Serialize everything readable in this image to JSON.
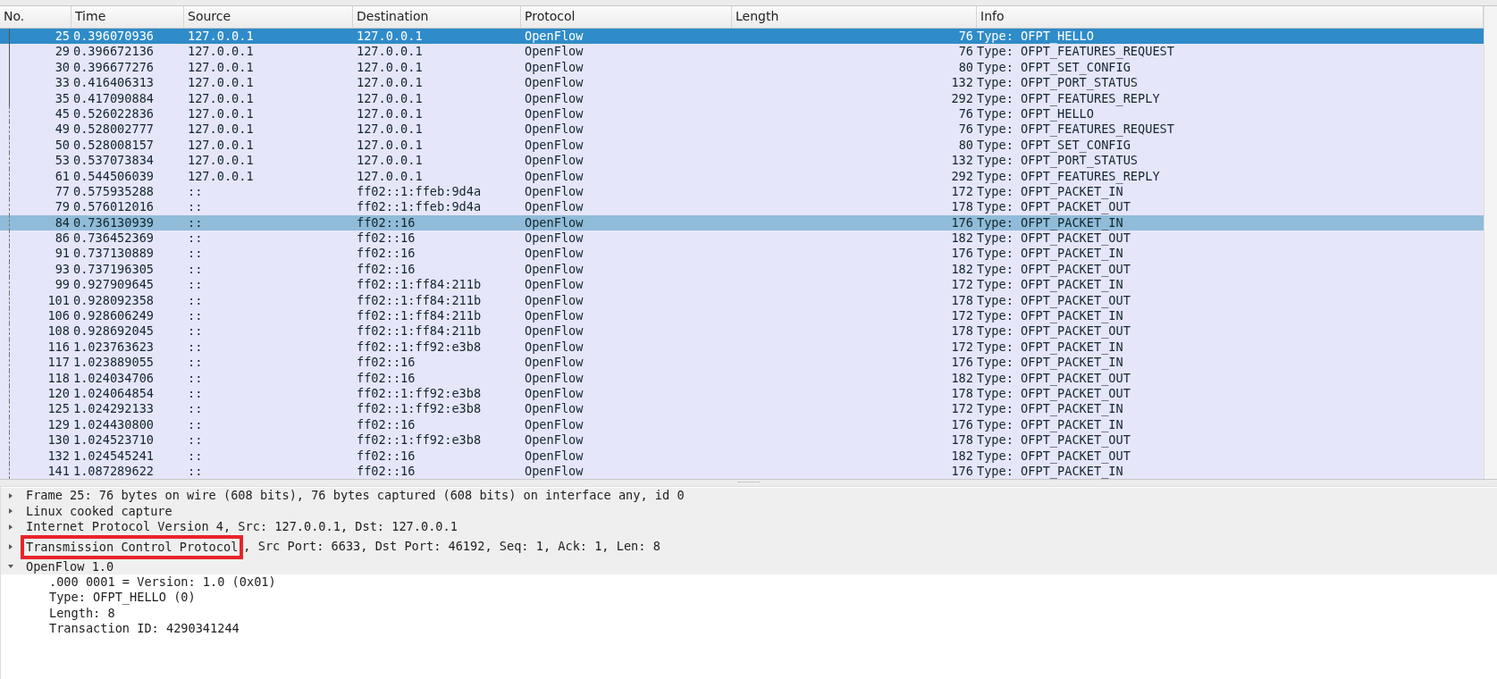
{
  "packet_list": {
    "columns": [
      "No.",
      "Time",
      "Source",
      "Destination",
      "Protocol",
      "Length",
      "Info"
    ],
    "rows": [
      {
        "no": "25",
        "time": "0.396070936",
        "source": "127.0.0.1",
        "destination": "127.0.0.1",
        "protocol": "OpenFlow",
        "length": "76",
        "info": "Type: OFPT_HELLO",
        "selected": true,
        "highlighted": false,
        "same_conversation": true
      },
      {
        "no": "29",
        "time": "0.396672136",
        "source": "127.0.0.1",
        "destination": "127.0.0.1",
        "protocol": "OpenFlow",
        "length": "76",
        "info": "Type: OFPT_FEATURES_REQUEST",
        "selected": false,
        "highlighted": false,
        "same_conversation": true
      },
      {
        "no": "30",
        "time": "0.396677276",
        "source": "127.0.0.1",
        "destination": "127.0.0.1",
        "protocol": "OpenFlow",
        "length": "80",
        "info": "Type: OFPT_SET_CONFIG",
        "selected": false,
        "highlighted": false,
        "same_conversation": true
      },
      {
        "no": "33",
        "time": "0.416406313",
        "source": "127.0.0.1",
        "destination": "127.0.0.1",
        "protocol": "OpenFlow",
        "length": "132",
        "info": "Type: OFPT_PORT_STATUS",
        "selected": false,
        "highlighted": false,
        "same_conversation": true
      },
      {
        "no": "35",
        "time": "0.417090884",
        "source": "127.0.0.1",
        "destination": "127.0.0.1",
        "protocol": "OpenFlow",
        "length": "292",
        "info": "Type: OFPT_FEATURES_REPLY",
        "selected": false,
        "highlighted": false,
        "same_conversation": true
      },
      {
        "no": "45",
        "time": "0.526022836",
        "source": "127.0.0.1",
        "destination": "127.0.0.1",
        "protocol": "OpenFlow",
        "length": "76",
        "info": "Type: OFPT_HELLO",
        "selected": false,
        "highlighted": false,
        "same_conversation": false
      },
      {
        "no": "49",
        "time": "0.528002777",
        "source": "127.0.0.1",
        "destination": "127.0.0.1",
        "protocol": "OpenFlow",
        "length": "76",
        "info": "Type: OFPT_FEATURES_REQUEST",
        "selected": false,
        "highlighted": false,
        "same_conversation": false
      },
      {
        "no": "50",
        "time": "0.528008157",
        "source": "127.0.0.1",
        "destination": "127.0.0.1",
        "protocol": "OpenFlow",
        "length": "80",
        "info": "Type: OFPT_SET_CONFIG",
        "selected": false,
        "highlighted": false,
        "same_conversation": false
      },
      {
        "no": "53",
        "time": "0.537073834",
        "source": "127.0.0.1",
        "destination": "127.0.0.1",
        "protocol": "OpenFlow",
        "length": "132",
        "info": "Type: OFPT_PORT_STATUS",
        "selected": false,
        "highlighted": false,
        "same_conversation": false
      },
      {
        "no": "61",
        "time": "0.544506039",
        "source": "127.0.0.1",
        "destination": "127.0.0.1",
        "protocol": "OpenFlow",
        "length": "292",
        "info": "Type: OFPT_FEATURES_REPLY",
        "selected": false,
        "highlighted": false,
        "same_conversation": false
      },
      {
        "no": "77",
        "time": "0.575935288",
        "source": "::",
        "destination": "ff02::1:ffeb:9d4a",
        "protocol": "OpenFlow",
        "length": "172",
        "info": "Type: OFPT_PACKET_IN",
        "selected": false,
        "highlighted": false,
        "same_conversation": false
      },
      {
        "no": "79",
        "time": "0.576012016",
        "source": "::",
        "destination": "ff02::1:ffeb:9d4a",
        "protocol": "OpenFlow",
        "length": "178",
        "info": "Type: OFPT_PACKET_OUT",
        "selected": false,
        "highlighted": false,
        "same_conversation": false
      },
      {
        "no": "84",
        "time": "0.736130939",
        "source": "::",
        "destination": "ff02::16",
        "protocol": "OpenFlow",
        "length": "176",
        "info": "Type: OFPT_PACKET_IN",
        "selected": false,
        "highlighted": true,
        "same_conversation": false
      },
      {
        "no": "86",
        "time": "0.736452369",
        "source": "::",
        "destination": "ff02::16",
        "protocol": "OpenFlow",
        "length": "182",
        "info": "Type: OFPT_PACKET_OUT",
        "selected": false,
        "highlighted": false,
        "same_conversation": false
      },
      {
        "no": "91",
        "time": "0.737130889",
        "source": "::",
        "destination": "ff02::16",
        "protocol": "OpenFlow",
        "length": "176",
        "info": "Type: OFPT_PACKET_IN",
        "selected": false,
        "highlighted": false,
        "same_conversation": false
      },
      {
        "no": "93",
        "time": "0.737196305",
        "source": "::",
        "destination": "ff02::16",
        "protocol": "OpenFlow",
        "length": "182",
        "info": "Type: OFPT_PACKET_OUT",
        "selected": false,
        "highlighted": false,
        "same_conversation": false
      },
      {
        "no": "99",
        "time": "0.927909645",
        "source": "::",
        "destination": "ff02::1:ff84:211b",
        "protocol": "OpenFlow",
        "length": "172",
        "info": "Type: OFPT_PACKET_IN",
        "selected": false,
        "highlighted": false,
        "same_conversation": false
      },
      {
        "no": "101",
        "time": "0.928092358",
        "source": "::",
        "destination": "ff02::1:ff84:211b",
        "protocol": "OpenFlow",
        "length": "178",
        "info": "Type: OFPT_PACKET_OUT",
        "selected": false,
        "highlighted": false,
        "same_conversation": false
      },
      {
        "no": "106",
        "time": "0.928606249",
        "source": "::",
        "destination": "ff02::1:ff84:211b",
        "protocol": "OpenFlow",
        "length": "172",
        "info": "Type: OFPT_PACKET_IN",
        "selected": false,
        "highlighted": false,
        "same_conversation": false
      },
      {
        "no": "108",
        "time": "0.928692045",
        "source": "::",
        "destination": "ff02::1:ff84:211b",
        "protocol": "OpenFlow",
        "length": "178",
        "info": "Type: OFPT_PACKET_OUT",
        "selected": false,
        "highlighted": false,
        "same_conversation": false
      },
      {
        "no": "116",
        "time": "1.023763623",
        "source": "::",
        "destination": "ff02::1:ff92:e3b8",
        "protocol": "OpenFlow",
        "length": "172",
        "info": "Type: OFPT_PACKET_IN",
        "selected": false,
        "highlighted": false,
        "same_conversation": false
      },
      {
        "no": "117",
        "time": "1.023889055",
        "source": "::",
        "destination": "ff02::16",
        "protocol": "OpenFlow",
        "length": "176",
        "info": "Type: OFPT_PACKET_IN",
        "selected": false,
        "highlighted": false,
        "same_conversation": false
      },
      {
        "no": "118",
        "time": "1.024034706",
        "source": "::",
        "destination": "ff02::16",
        "protocol": "OpenFlow",
        "length": "182",
        "info": "Type: OFPT_PACKET_OUT",
        "selected": false,
        "highlighted": false,
        "same_conversation": false
      },
      {
        "no": "120",
        "time": "1.024064854",
        "source": "::",
        "destination": "ff02::1:ff92:e3b8",
        "protocol": "OpenFlow",
        "length": "178",
        "info": "Type: OFPT_PACKET_OUT",
        "selected": false,
        "highlighted": false,
        "same_conversation": false
      },
      {
        "no": "125",
        "time": "1.024292133",
        "source": "::",
        "destination": "ff02::1:ff92:e3b8",
        "protocol": "OpenFlow",
        "length": "172",
        "info": "Type: OFPT_PACKET_IN",
        "selected": false,
        "highlighted": false,
        "same_conversation": false
      },
      {
        "no": "129",
        "time": "1.024430800",
        "source": "::",
        "destination": "ff02::16",
        "protocol": "OpenFlow",
        "length": "176",
        "info": "Type: OFPT_PACKET_IN",
        "selected": false,
        "highlighted": false,
        "same_conversation": false
      },
      {
        "no": "130",
        "time": "1.024523710",
        "source": "::",
        "destination": "ff02::1:ff92:e3b8",
        "protocol": "OpenFlow",
        "length": "178",
        "info": "Type: OFPT_PACKET_OUT",
        "selected": false,
        "highlighted": false,
        "same_conversation": false
      },
      {
        "no": "132",
        "time": "1.024545241",
        "source": "::",
        "destination": "ff02::16",
        "protocol": "OpenFlow",
        "length": "182",
        "info": "Type: OFPT_PACKET_OUT",
        "selected": false,
        "highlighted": false,
        "same_conversation": false
      },
      {
        "no": "141",
        "time": "1.087289622",
        "source": "::",
        "destination": "ff02::16",
        "protocol": "OpenFlow",
        "length": "176",
        "info": "Type: OFPT_PACKET_IN",
        "selected": false,
        "highlighted": false,
        "same_conversation": false
      }
    ]
  },
  "packet_details": [
    {
      "name": "Frame 25: 76 bytes on wire (608 bits), 76 bytes captured (608 bits) on interface any, id 0",
      "expanded": false,
      "annotated": false
    },
    {
      "name": "Linux cooked capture",
      "expanded": false,
      "annotated": false
    },
    {
      "name": "Internet Protocol Version 4, Src: 127.0.0.1, Dst: 127.0.0.1",
      "expanded": false,
      "annotated": false
    },
    {
      "name": "Transmission Control Protocol",
      "summary": ", Src Port: 6633, Dst Port: 46192, Seq: 1, Ack: 1, Len: 8",
      "expanded": false,
      "annotated": true
    },
    {
      "name": "OpenFlow 1.0",
      "expanded": true,
      "annotated": false,
      "children": [
        {
          "name": ".000 0001 = Version: 1.0 (0x01)"
        },
        {
          "name": "Type: OFPT_HELLO (0)"
        },
        {
          "name": "Length: 8"
        },
        {
          "name": "Transaction ID: 4290341244"
        }
      ]
    }
  ]
}
